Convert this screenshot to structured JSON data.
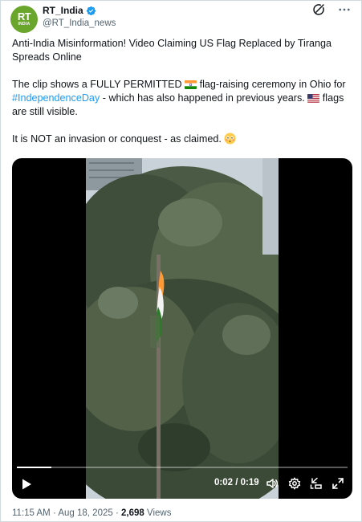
{
  "author": {
    "display_name": "RT_India",
    "handle": "@RT_India_news",
    "avatar_text": "RT",
    "avatar_subtext": "INDIA",
    "avatar_color": "#6aa52c",
    "verified_color": "#1d9bf0"
  },
  "tweet": {
    "line1": "Anti-India Misinformation! Video Claiming US Flag Replaced by Tiranga Spreads Online",
    "p2_part1": "The clip shows a FULLY PERMITTED ",
    "p2_part2": " flag-raising ceremony in Ohio for ",
    "hashtag": "#IndependenceDay",
    "p2_part3": " - which has also happened in previous years. ",
    "p2_part4": " flags are still visible.",
    "p3": "It is NOT an invasion or conquest - as claimed. ",
    "hashtag_color": "#1d9bf0"
  },
  "video": {
    "time": "0:02 / 0:19",
    "progress": 0.105
  },
  "meta": {
    "time": "11:15 AM",
    "sep1": " · ",
    "date": "Aug 18, 2025",
    "sep2": " · ",
    "views_count": "2,698",
    "views_label": " Views"
  },
  "icons": {
    "grok": "grok-icon",
    "more": "more-icon",
    "play": "play-icon",
    "volume": "volume-icon",
    "settings": "settings-icon",
    "pip": "pip-icon",
    "fullscreen": "fullscreen-icon"
  }
}
